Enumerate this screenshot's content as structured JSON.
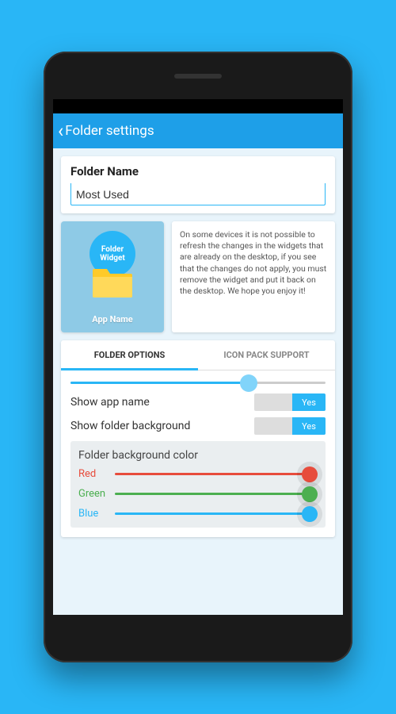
{
  "appbar": {
    "title": "Folder settings"
  },
  "folderName": {
    "label": "Folder Name",
    "value": "Most Used"
  },
  "preview": {
    "circleText": "Folder Widget",
    "appName": "App Name"
  },
  "info": {
    "text": "On some devices it is not possible to refresh the changes in the widgets that are already on the desktop, if you see that the changes do not apply, you must remove the widget and put it back on the desktop. We hope you enjoy it!"
  },
  "tabs": {
    "folderOptions": "FOLDER OPTIONS",
    "iconPackSupport": "ICON PACK SUPPORT"
  },
  "options": {
    "sizeSliderPercent": 70,
    "showAppName": {
      "label": "Show app name",
      "value": "Yes"
    },
    "showFolderBg": {
      "label": "Show folder background",
      "value": "Yes"
    }
  },
  "colorPanel": {
    "title": "Folder background color",
    "red": {
      "label": "Red",
      "percent": 96,
      "color": "#e74c3c"
    },
    "green": {
      "label": "Green",
      "percent": 96,
      "color": "#4caf50"
    },
    "blue": {
      "label": "Blue",
      "percent": 96,
      "color": "#29b6f6"
    }
  }
}
